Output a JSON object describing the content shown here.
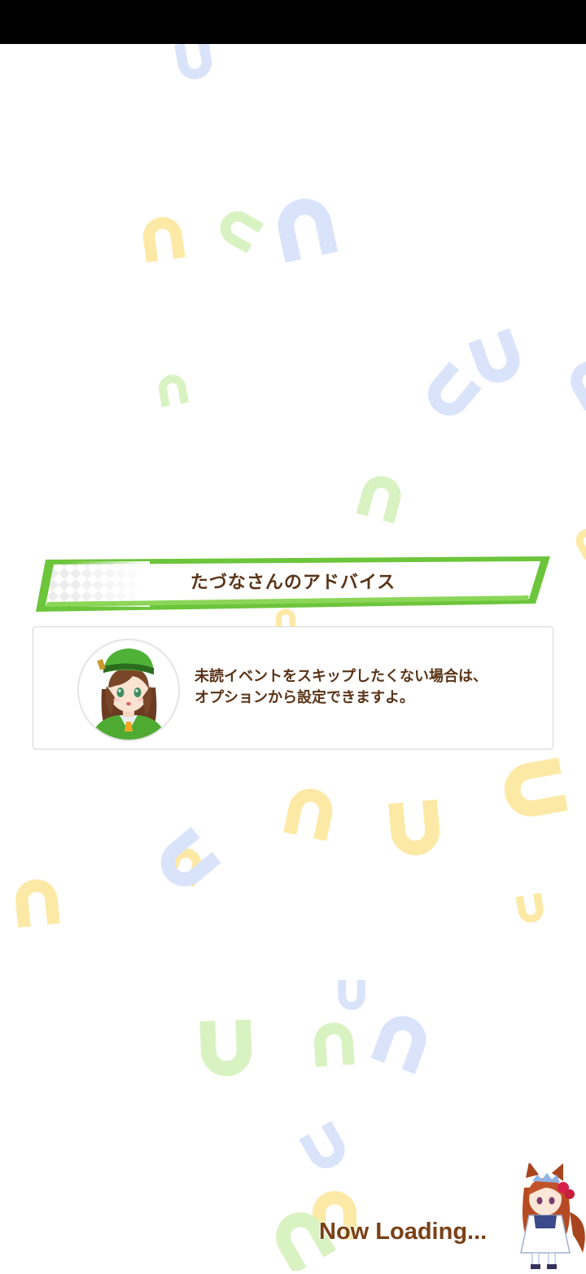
{
  "advice": {
    "title": "たづなさんのアドバイス",
    "message_line1": "未読イベントをスキップしたくない場合は、",
    "message_line2": "オプションから設定できますよ。",
    "avatar_icon": "tazuna-portrait-icon"
  },
  "loading": {
    "text": "Now Loading...",
    "mascot_icon": "chibi-horse-girl-icon"
  },
  "colors": {
    "banner_green": "#6cc53a",
    "text_brown": "#5a3418",
    "loading_brown": "#7a4116",
    "shoe_yellow": "#fde9a6",
    "shoe_green": "#d9f2c2",
    "shoe_blue": "#d9e4fb"
  }
}
